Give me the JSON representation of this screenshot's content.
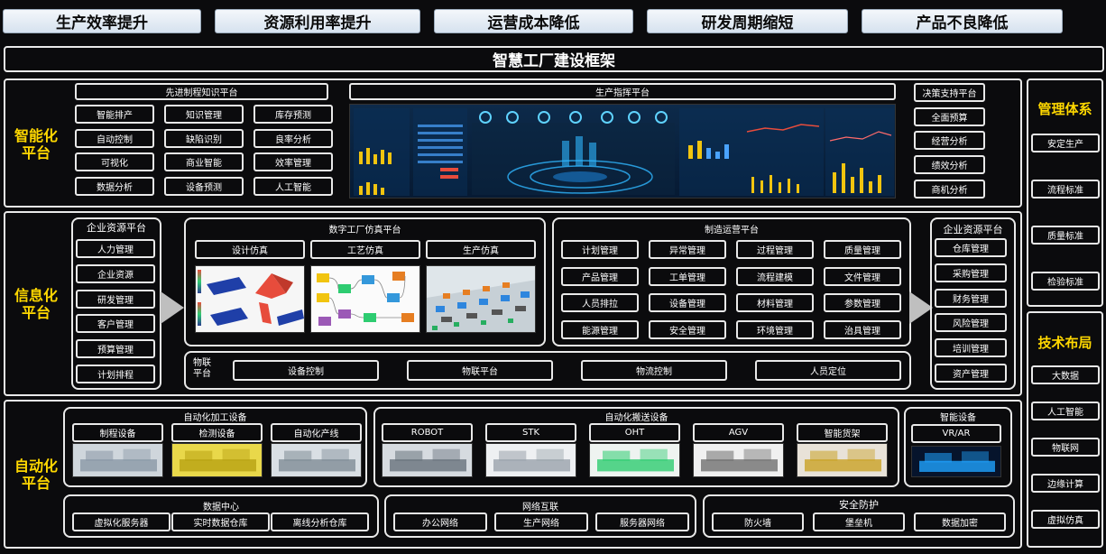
{
  "goals": [
    "生产效率提升",
    "资源利用率提升",
    "运营成本降低",
    "研发周期缩短",
    "产品不良降低"
  ],
  "framework_title": "智慧工厂建设框架",
  "intelligent": {
    "label": "智能化平台",
    "knowledge_title": "先进制程知识平台",
    "knowledge_items": [
      "智能排产",
      "知识管理",
      "库存预测",
      "自动控制",
      "缺陷识别",
      "良率分析",
      "可视化",
      "商业智能",
      "效率管理",
      "数据分析",
      "设备预测",
      "人工智能"
    ],
    "command_title": "生产指挥平台",
    "decision_items": [
      "决策支持平台",
      "全面预算",
      "经营分析",
      "绩效分析",
      "商机分析"
    ]
  },
  "informatization": {
    "label": "信息化平台",
    "erp_left_title": "企业资源平台",
    "erp_left_items": [
      "人力管理",
      "企业资源",
      "研发管理",
      "客户管理",
      "预算管理",
      "计划排程"
    ],
    "sim_title": "数字工厂仿真平台",
    "sim_items": [
      "设计仿真",
      "工艺仿真",
      "生产仿真"
    ],
    "mfg_title": "制造运营平台",
    "mfg_items": [
      "计划管理",
      "异常管理",
      "过程管理",
      "质量管理",
      "产品管理",
      "工单管理",
      "流程建模",
      "文件管理",
      "人员排拉",
      "设备管理",
      "材料管理",
      "参数管理",
      "能源管理",
      "安全管理",
      "环境管理",
      "治具管理"
    ],
    "iot_title": "物联\n平台",
    "iot_items": [
      "设备控制",
      "物联平台",
      "物流控制",
      "人员定位"
    ],
    "erp_right_title": "企业资源平台",
    "erp_right_items": [
      "仓库管理",
      "采购管理",
      "财务管理",
      "风险管理",
      "培训管理",
      "资产管理"
    ]
  },
  "automation": {
    "label": "自动化平台",
    "processing_title": "自动化加工设备",
    "processing_items": [
      "制程设备",
      "检测设备",
      "自动化产线"
    ],
    "handling_title": "自动化搬送设备",
    "handling_items": [
      "ROBOT",
      "STK",
      "OHT",
      "AGV",
      "智能货架"
    ],
    "smart_title": "智能设备",
    "smart_items": [
      "VR/AR"
    ],
    "dc_title": "数据中心",
    "dc_items": [
      "虚拟化服务器",
      "实时数据仓库",
      "离线分析仓库"
    ],
    "net_title": "网络互联",
    "net_items": [
      "办公网络",
      "生产网络",
      "服务器网络"
    ],
    "sec_title": "安全防护",
    "sec_items": [
      "防火墙",
      "堡垒机",
      "数据加密"
    ]
  },
  "management": {
    "title": "管理体系",
    "items": [
      "安定生产",
      "流程标准",
      "质量标准",
      "检验标准"
    ]
  },
  "technology": {
    "title": "技术布局",
    "items": [
      "大数据",
      "人工智能",
      "物联网",
      "边缘计算",
      "虚拟仿真"
    ]
  },
  "colors": {
    "accent": "#ffd800",
    "frame": "#e9e9e9",
    "background": "#0b0b0d"
  }
}
